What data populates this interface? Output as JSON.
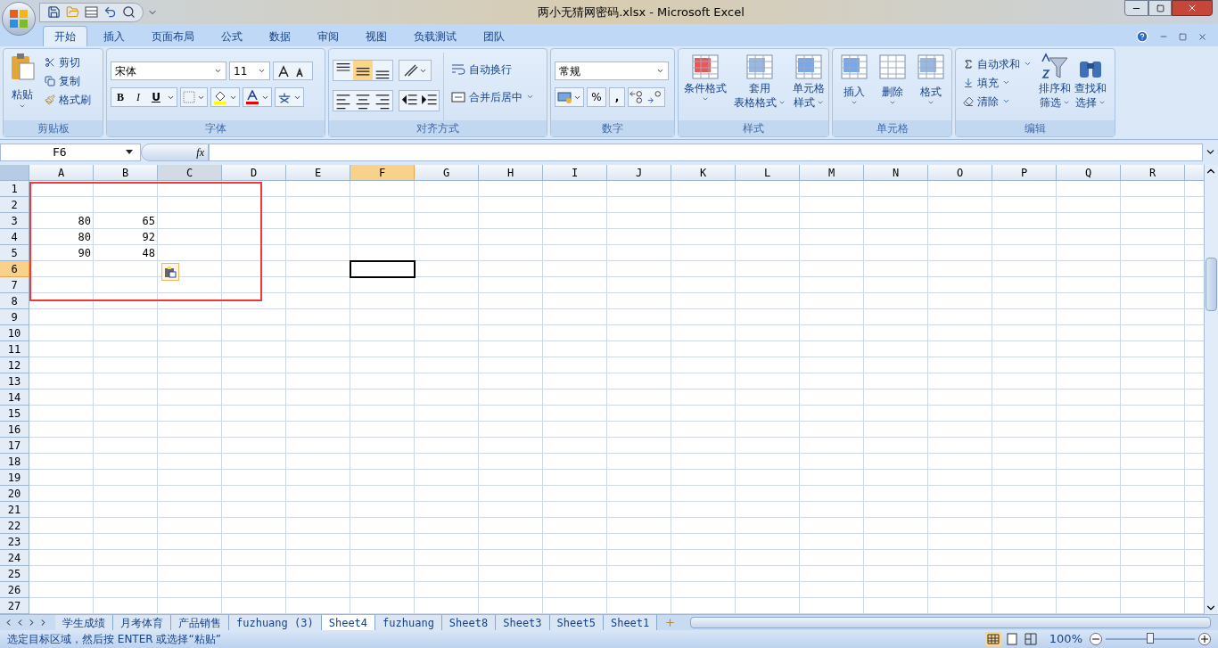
{
  "window": {
    "title": "两小无猜网密码.xlsx - Microsoft Excel"
  },
  "ribbon_tabs": [
    {
      "label": "开始",
      "selected": true
    },
    {
      "label": "插入",
      "selected": false
    },
    {
      "label": "页面布局",
      "selected": false
    },
    {
      "label": "公式",
      "selected": false
    },
    {
      "label": "数据",
      "selected": false
    },
    {
      "label": "审阅",
      "selected": false
    },
    {
      "label": "视图",
      "selected": false
    },
    {
      "label": "负载测试",
      "selected": false
    },
    {
      "label": "团队",
      "selected": false
    }
  ],
  "clipboard": {
    "title": "剪贴板",
    "paste": "粘贴",
    "cut": "剪切",
    "copy": "复制",
    "format_painter": "格式刷"
  },
  "font": {
    "title": "字体",
    "family": "宋体",
    "size": "11",
    "bold": "B",
    "italic": "I",
    "underline": "U"
  },
  "alignment": {
    "title": "对齐方式",
    "wrap": "自动换行",
    "merge": "合并后居中"
  },
  "number": {
    "title": "数字",
    "format": "常规",
    "percent": "%",
    "comma": ","
  },
  "styles": {
    "title": "样式",
    "buttons": [
      {
        "lines": [
          "条件格式"
        ]
      },
      {
        "lines": [
          "套用",
          "表格格式"
        ]
      },
      {
        "lines": [
          "单元格",
          "样式"
        ]
      }
    ]
  },
  "cells_group": {
    "title": "单元格",
    "buttons": [
      "插入",
      "删除",
      "格式"
    ]
  },
  "editing": {
    "title": "编辑",
    "autosum": "自动求和",
    "fill": "填充",
    "clear": "清除",
    "sort": [
      "排序和",
      "筛选"
    ],
    "find": [
      "查找和",
      "选择"
    ]
  },
  "formula_bar": {
    "name_box": "F6",
    "fx": "fx"
  },
  "columns": [
    {
      "label": "A",
      "selected": false,
      "hovered": false
    },
    {
      "label": "B",
      "selected": false,
      "hovered": false
    },
    {
      "label": "C",
      "selected": false,
      "hovered": true
    },
    {
      "label": "D",
      "selected": false,
      "hovered": false
    },
    {
      "label": "E",
      "selected": false,
      "hovered": false
    },
    {
      "label": "F",
      "selected": true,
      "hovered": false
    },
    {
      "label": "G",
      "selected": false,
      "hovered": false
    },
    {
      "label": "H",
      "selected": false,
      "hovered": false
    },
    {
      "label": "I",
      "selected": false,
      "hovered": false
    },
    {
      "label": "J",
      "selected": false,
      "hovered": false
    },
    {
      "label": "K",
      "selected": false,
      "hovered": false
    },
    {
      "label": "L",
      "selected": false,
      "hovered": false
    },
    {
      "label": "M",
      "selected": false,
      "hovered": false
    },
    {
      "label": "N",
      "selected": false,
      "hovered": false
    },
    {
      "label": "O",
      "selected": false,
      "hovered": false
    },
    {
      "label": "P",
      "selected": false,
      "hovered": false
    },
    {
      "label": "Q",
      "selected": false,
      "hovered": false
    },
    {
      "label": "R",
      "selected": false,
      "hovered": false
    }
  ],
  "rows": [
    {
      "label": "1",
      "selected": false
    },
    {
      "label": "2",
      "selected": false
    },
    {
      "label": "3",
      "selected": false,
      "cells": [
        "80",
        "65"
      ]
    },
    {
      "label": "4",
      "selected": false,
      "cells": [
        "80",
        "92"
      ]
    },
    {
      "label": "5",
      "selected": false,
      "cells": [
        "90",
        "48"
      ]
    },
    {
      "label": "6",
      "selected": true
    },
    {
      "label": "7",
      "selected": false
    },
    {
      "label": "8",
      "selected": false
    },
    {
      "label": "9",
      "selected": false
    },
    {
      "label": "10",
      "selected": false
    },
    {
      "label": "11",
      "selected": false
    },
    {
      "label": "12",
      "selected": false
    },
    {
      "label": "13",
      "selected": false
    },
    {
      "label": "14",
      "selected": false
    },
    {
      "label": "15",
      "selected": false
    },
    {
      "label": "16",
      "selected": false
    },
    {
      "label": "17",
      "selected": false
    },
    {
      "label": "18",
      "selected": false
    },
    {
      "label": "19",
      "selected": false
    },
    {
      "label": "20",
      "selected": false
    },
    {
      "label": "21",
      "selected": false
    },
    {
      "label": "22",
      "selected": false
    },
    {
      "label": "23",
      "selected": false
    },
    {
      "label": "24",
      "selected": false
    },
    {
      "label": "25",
      "selected": false
    },
    {
      "label": "26",
      "selected": false
    },
    {
      "label": "27",
      "selected": false
    }
  ],
  "sheet_tabs": [
    {
      "label": "学生成绩",
      "selected": false
    },
    {
      "label": "月考体育",
      "selected": false
    },
    {
      "label": "产品销售",
      "selected": false
    },
    {
      "label": "fuzhuang (3)",
      "selected": false
    },
    {
      "label": "Sheet4",
      "selected": true
    },
    {
      "label": "fuzhuang",
      "selected": false
    },
    {
      "label": "Sheet8",
      "selected": false
    },
    {
      "label": "Sheet3",
      "selected": false
    },
    {
      "label": "Sheet5",
      "selected": false
    },
    {
      "label": "Sheet1",
      "selected": false
    }
  ],
  "status_bar": {
    "message": "选定目标区域，然后按 ENTER 或选择“粘贴”",
    "zoom": "100%",
    "zoom_slider": {
      "level": 0.5
    }
  }
}
